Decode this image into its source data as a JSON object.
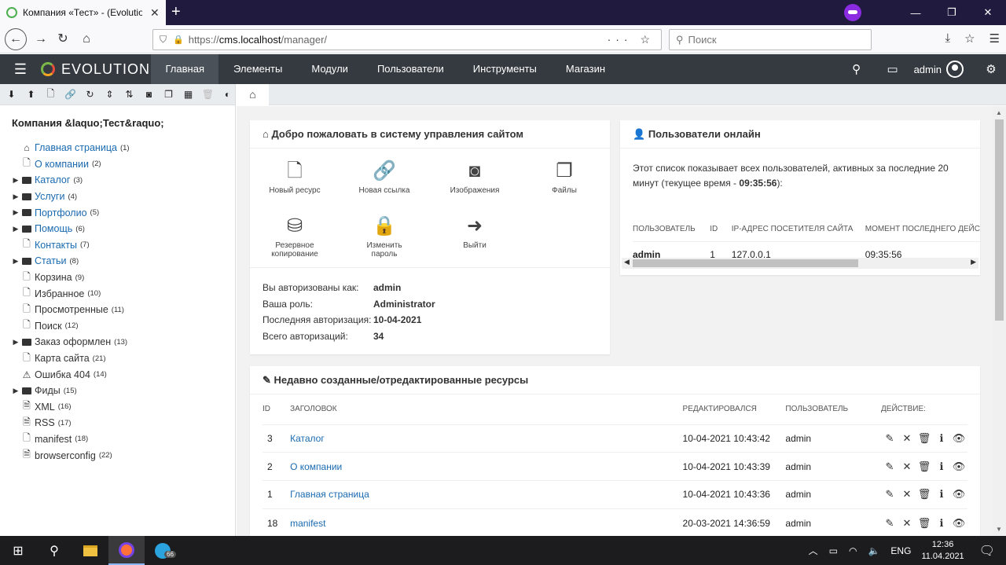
{
  "browser": {
    "tab_title": "Компания «Тест» - (Evolution",
    "new_tab": "+",
    "url_prefix": "https://",
    "url_host": "cms.localhost",
    "url_path": "/manager/",
    "search_placeholder": "Поиск"
  },
  "header": {
    "logo": "EVOLUTION",
    "menu": [
      "Главная",
      "Элементы",
      "Модули",
      "Пользователи",
      "Инструменты",
      "Магазин"
    ],
    "active_menu": "Главная",
    "user": "admin"
  },
  "sidebar": {
    "site_name": "Компания &laquo;Тест&raquo;",
    "tree": [
      {
        "label": "Главная страница",
        "count": "(1)",
        "icon": "home-icon",
        "link": true,
        "expandable": false
      },
      {
        "label": "О компании",
        "count": "(2)",
        "icon": "document-icon",
        "link": true,
        "expandable": false
      },
      {
        "label": "Каталог",
        "count": "(3)",
        "icon": "folder-icon",
        "link": true,
        "expandable": true
      },
      {
        "label": "Услуги",
        "count": "(4)",
        "icon": "folder-icon",
        "link": true,
        "expandable": true
      },
      {
        "label": "Портфолио",
        "count": "(5)",
        "icon": "folder-icon",
        "link": true,
        "expandable": true
      },
      {
        "label": "Помощь",
        "count": "(6)",
        "icon": "folder-icon",
        "link": true,
        "expandable": true
      },
      {
        "label": "Контакты",
        "count": "(7)",
        "icon": "document-icon",
        "link": true,
        "expandable": false
      },
      {
        "label": "Статьи",
        "count": "(8)",
        "icon": "folder-icon",
        "link": true,
        "expandable": true
      },
      {
        "label": "Корзина",
        "count": "(9)",
        "icon": "document-icon",
        "link": false,
        "expandable": false
      },
      {
        "label": "Избранное",
        "count": "(10)",
        "icon": "document-icon",
        "link": false,
        "expandable": false
      },
      {
        "label": "Просмотренные",
        "count": "(11)",
        "icon": "document-icon",
        "link": false,
        "expandable": false
      },
      {
        "label": "Поиск",
        "count": "(12)",
        "icon": "document-icon",
        "link": false,
        "expandable": false
      },
      {
        "label": "Заказ оформлен",
        "count": "(13)",
        "icon": "folder-icon",
        "link": false,
        "expandable": true
      },
      {
        "label": "Карта сайта",
        "count": "(21)",
        "icon": "document-icon",
        "link": false,
        "expandable": false
      },
      {
        "label": "Ошибка 404",
        "count": "(14)",
        "icon": "warning-icon",
        "link": false,
        "expandable": false
      },
      {
        "label": "Фиды",
        "count": "(15)",
        "icon": "folder-icon",
        "link": false,
        "expandable": true
      },
      {
        "label": "XML",
        "count": "(16)",
        "icon": "code-file-icon",
        "link": false,
        "expandable": false
      },
      {
        "label": "RSS",
        "count": "(17)",
        "icon": "code-file-icon",
        "link": false,
        "expandable": false
      },
      {
        "label": "manifest",
        "count": "(18)",
        "icon": "document-icon",
        "link": false,
        "expandable": false
      },
      {
        "label": "browserconfig",
        "count": "(22)",
        "icon": "code-file-icon",
        "link": false,
        "expandable": false
      }
    ]
  },
  "welcome": {
    "title": "Добро пожаловать в систему управления сайтом",
    "actions": [
      {
        "label": "Новый ресурс",
        "icon": "new-document-icon"
      },
      {
        "label": "Новая ссылка",
        "icon": "link-icon"
      },
      {
        "label": "Изображения",
        "icon": "camera-icon"
      },
      {
        "label": "Файлы",
        "icon": "files-icon"
      },
      {
        "label": "Резервное копирование",
        "icon": "database-icon"
      },
      {
        "label": "Изменить пароль",
        "icon": "lock-icon"
      },
      {
        "label": "Выйти",
        "icon": "sign-out-icon"
      }
    ],
    "info": [
      {
        "key": "Вы авторизованы как:",
        "value": "admin"
      },
      {
        "key": "Ваша роль:",
        "value": "Administrator"
      },
      {
        "key": "Последняя авторизация:",
        "value": "10-04-2021"
      },
      {
        "key": "Всего авторизаций:",
        "value": "34"
      }
    ]
  },
  "online": {
    "title": "Пользователи онлайн",
    "description_1": "Этот список показывает всех пользователей, активных за последние 20 минут (текущее время - ",
    "time": "09:35:56",
    "description_2": "):",
    "columns": [
      "Пользователь",
      "ID",
      "IP-адрес посетителя сайта",
      "Момент последнего дейс"
    ],
    "row": {
      "user": "admin",
      "id": "1",
      "ip": "127.0.0.1",
      "time": "09:35:56"
    }
  },
  "recent": {
    "title": "Недавно созданные/отредактированные ресурсы",
    "columns": [
      "ID",
      "Заголовок",
      "Редактировался",
      "Пользователь",
      "Действие:"
    ],
    "rows": [
      {
        "id": "3",
        "title": "Каталог",
        "edited": "10-04-2021 10:43:42",
        "user": "admin"
      },
      {
        "id": "2",
        "title": "О компании",
        "edited": "10-04-2021 10:43:39",
        "user": "admin"
      },
      {
        "id": "1",
        "title": "Главная страница",
        "edited": "10-04-2021 10:43:36",
        "user": "admin"
      },
      {
        "id": "18",
        "title": "manifest",
        "edited": "20-03-2021 14:36:59",
        "user": "admin"
      }
    ]
  },
  "taskbar": {
    "lang": "ENG",
    "time": "12:36",
    "date": "11.04.2021",
    "telegram_badge": "66"
  },
  "colors": {
    "header_bg": "#343a40",
    "link": "#1a6ab0",
    "content_bg": "#f2f2f2"
  }
}
